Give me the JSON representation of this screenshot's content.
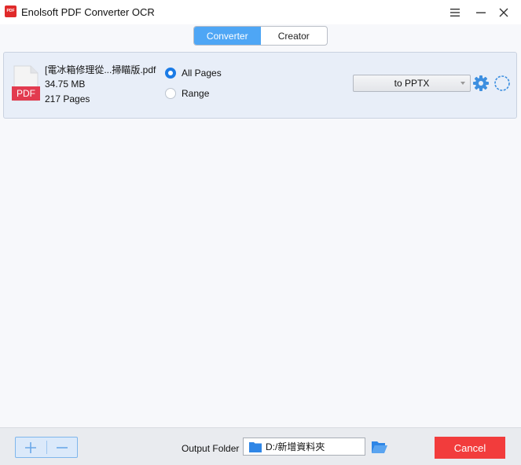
{
  "window": {
    "logo_text": "PDF",
    "title": "Enolsoft PDF Converter OCR"
  },
  "tabs": [
    {
      "label": "Converter",
      "active": true
    },
    {
      "label": "Creator",
      "active": false
    }
  ],
  "file": {
    "badge": "PDF",
    "name": "[電冰箱修理從...掃瞄版.pdf",
    "size": "34.75 MB",
    "pages": "217 Pages",
    "page_options": [
      {
        "label": "All Pages",
        "checked": true
      },
      {
        "label": "Range",
        "checked": false
      }
    ],
    "format": "to PPTX"
  },
  "bottom": {
    "output_label": "Output Folder",
    "output_path": "D:/新增資料夾",
    "cancel_label": "Cancel"
  },
  "colors": {
    "accent": "#4ea6f5",
    "radio": "#1b7be6",
    "cancel": "#f23c3c",
    "pdf_badge": "#e23b4f"
  },
  "icons": [
    "menu-icon",
    "minimize-icon",
    "close-icon",
    "document-icon",
    "gear-icon",
    "loading-spinner-icon",
    "add-icon",
    "remove-icon",
    "folder-icon",
    "open-folder-icon"
  ]
}
